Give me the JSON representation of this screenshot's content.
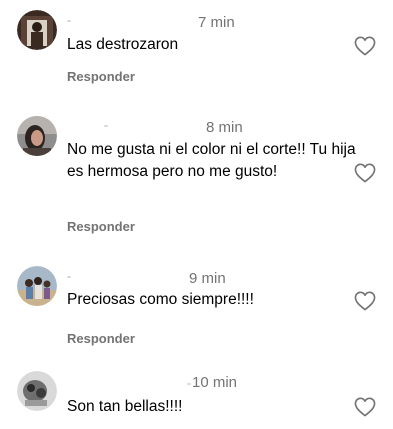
{
  "comments": [
    {
      "time": "7 min",
      "text": "Las destrozaron",
      "reply_label": "Responder",
      "avatar_icon": "user-avatar-photo",
      "like_icon": "heart-outline-icon"
    },
    {
      "time": "8 min",
      "text": "No me gusta ni el color ni el corte!! Tu hija es hermosa pero no me gusto!",
      "reply_label": "Responder",
      "avatar_icon": "user-avatar-photo",
      "like_icon": "heart-outline-icon"
    },
    {
      "time": "9 min",
      "text": "Preciosas como siempre!!!!",
      "reply_label": "Responder",
      "avatar_icon": "user-avatar-photo",
      "like_icon": "heart-outline-icon"
    },
    {
      "time": "10 min",
      "text": "Son tan bellas!!!!",
      "reply_label": "",
      "avatar_icon": "user-avatar-photo",
      "like_icon": "heart-outline-icon"
    }
  ],
  "colors": {
    "text": "#000000",
    "secondary": "#737373",
    "background": "#ffffff"
  }
}
